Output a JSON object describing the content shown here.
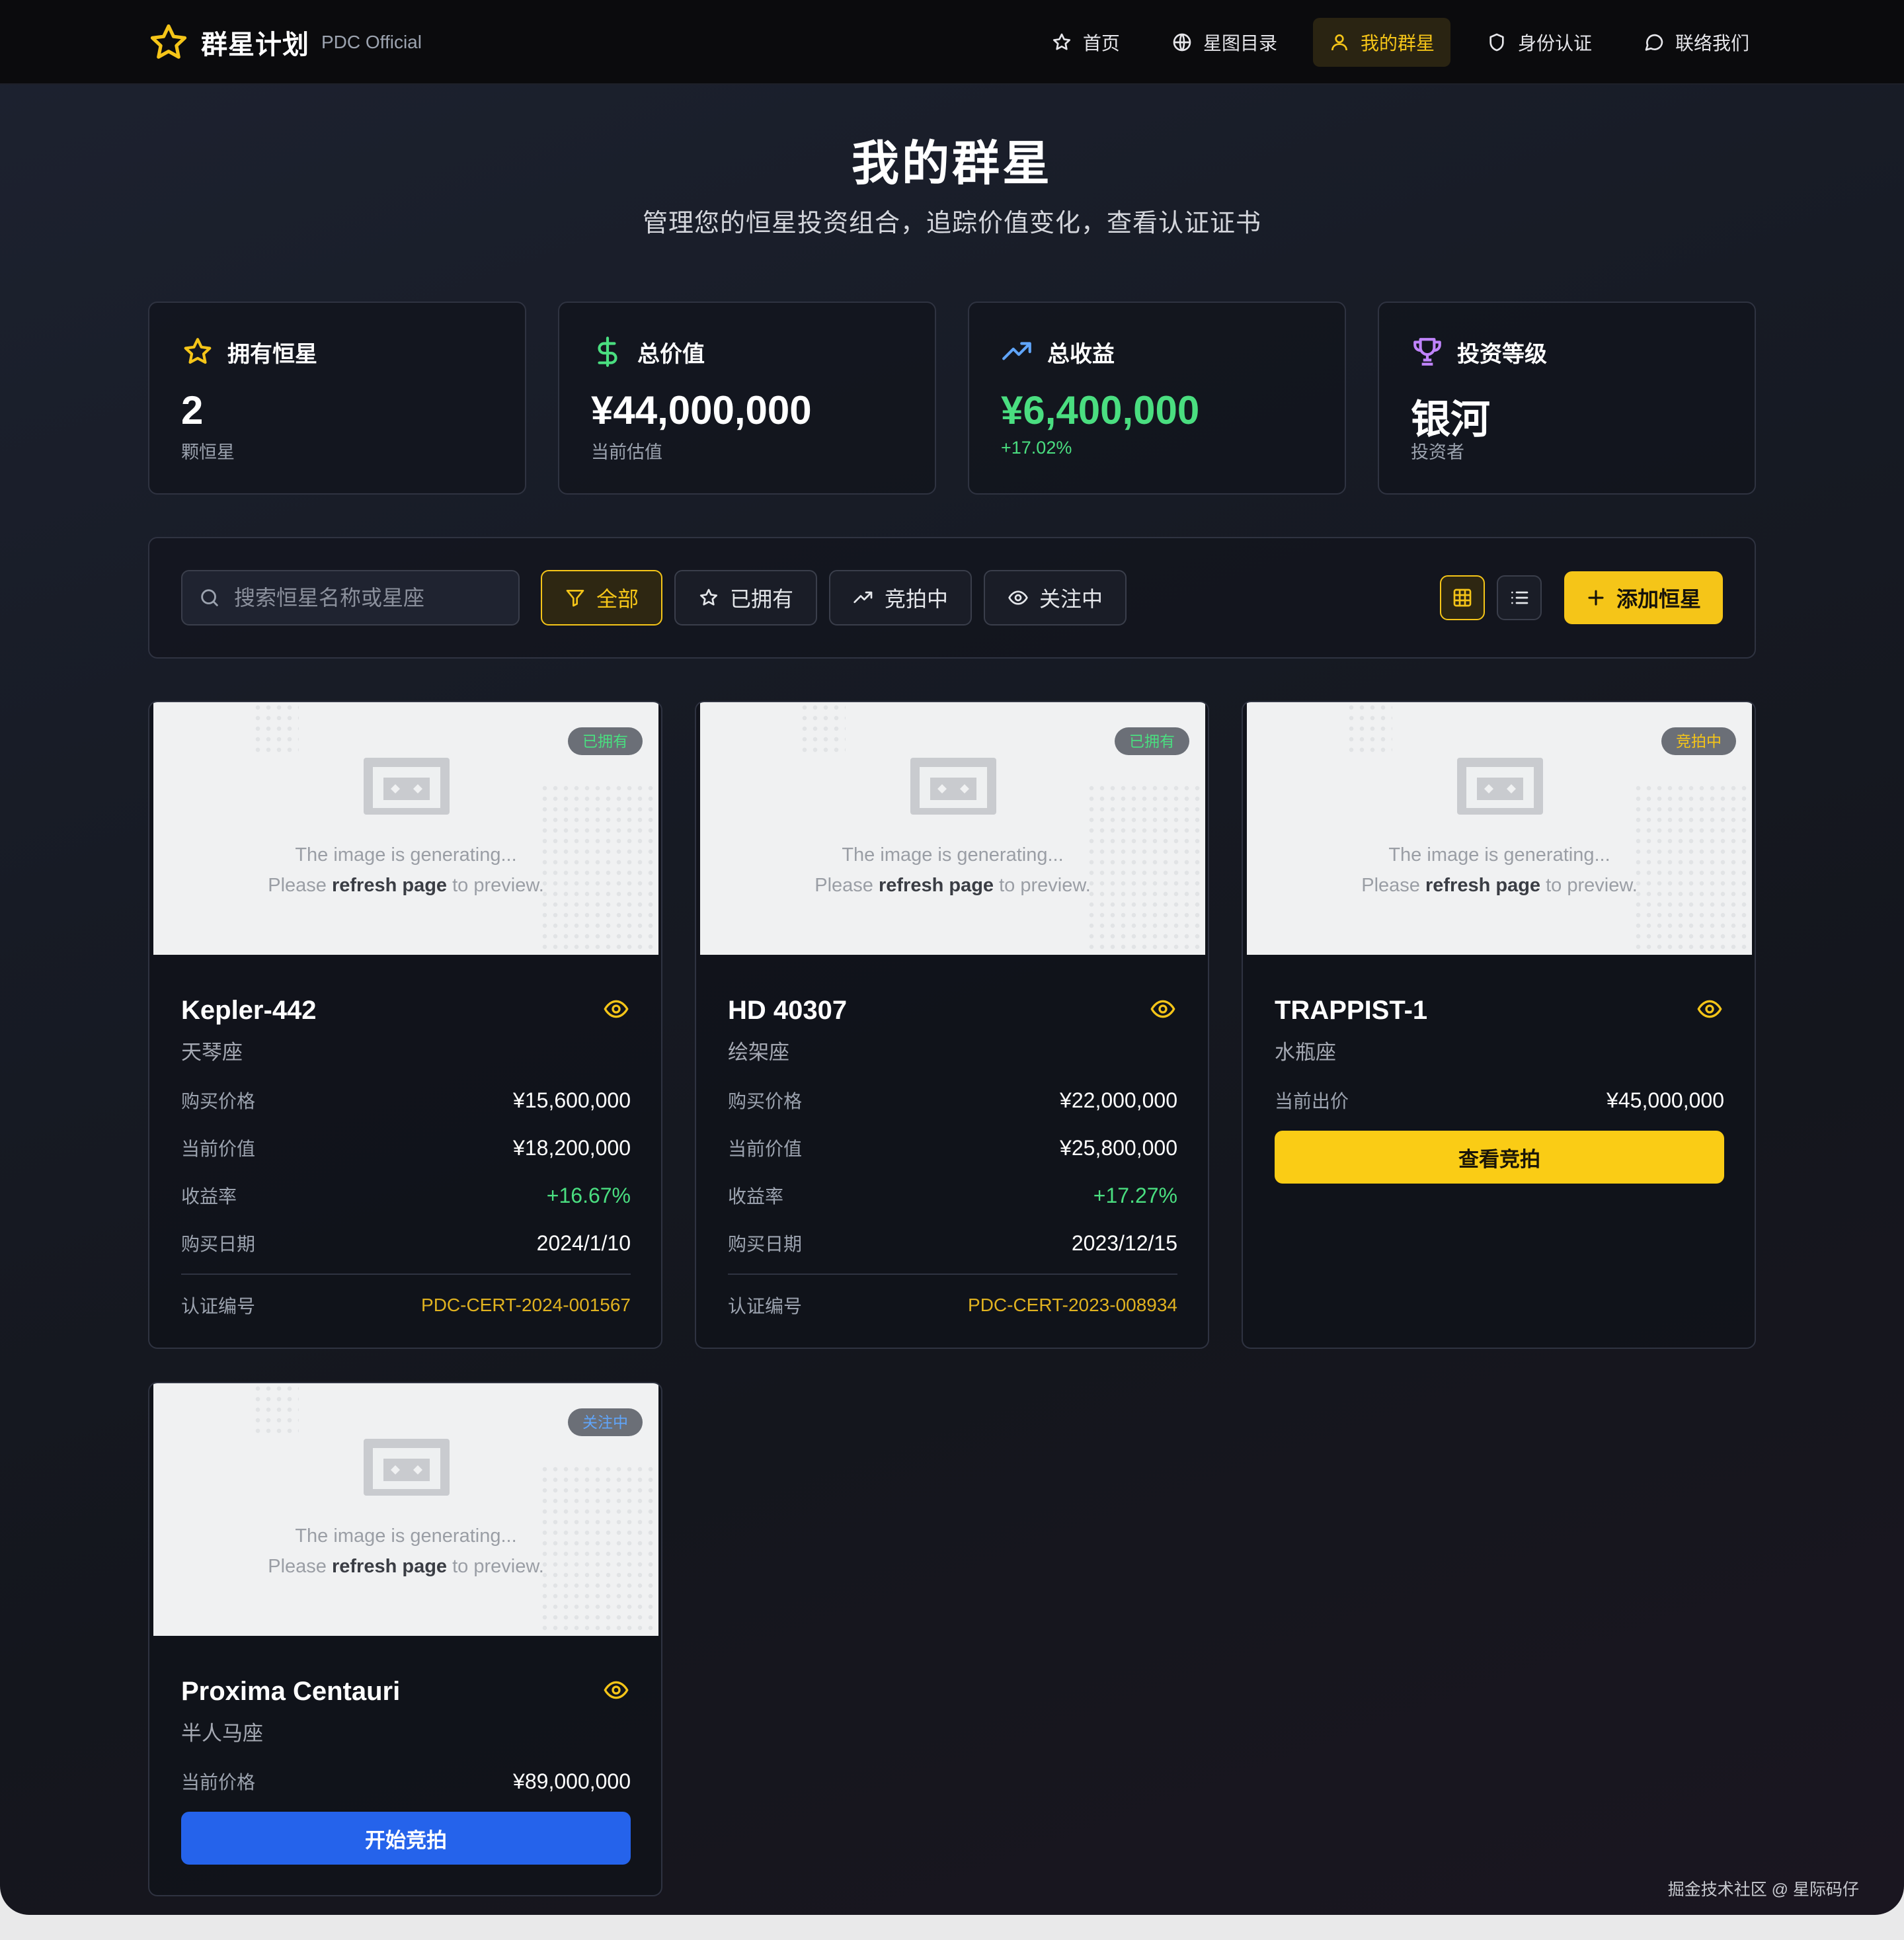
{
  "nav": {
    "brand_name": "群星计划",
    "brand_sub": "PDC Official",
    "links": [
      {
        "label": "首页",
        "icon": "star-icon"
      },
      {
        "label": "星图目录",
        "icon": "globe-icon"
      },
      {
        "label": "我的群星",
        "icon": "user-icon",
        "active": true
      },
      {
        "label": "身份认证",
        "icon": "shield-icon"
      },
      {
        "label": "联络我们",
        "icon": "message-icon"
      }
    ]
  },
  "hero": {
    "title": "我的群星",
    "subtitle": "管理您的恒星投资组合，追踪价值变化，查看认证证书"
  },
  "stats": [
    {
      "label": "拥有恒星",
      "value": "2",
      "note": "颗恒星",
      "icon": "star-outline-icon"
    },
    {
      "label": "总价值",
      "value": "¥44,000,000",
      "note": "当前估值",
      "icon": "dollar-icon"
    },
    {
      "label": "总收益",
      "value": "¥6,400,000",
      "note": "+17.02%",
      "icon": "trending-up-icon"
    },
    {
      "label": "投资等级",
      "value": "银河",
      "note": "投资者",
      "icon": "trophy-icon"
    }
  ],
  "toolbar": {
    "search_placeholder": "搜索恒星名称或星座",
    "filters": [
      {
        "label": "全部",
        "icon": "filter-icon",
        "active": true
      },
      {
        "label": "已拥有",
        "icon": "star-icon"
      },
      {
        "label": "竞拍中",
        "icon": "trending-up-icon"
      },
      {
        "label": "关注中",
        "icon": "eye-icon"
      }
    ],
    "view_grid": "grid-icon",
    "view_list": "list-icon",
    "add_label": "添加恒星"
  },
  "placeholder": {
    "line1": "The image is generating...",
    "line2_pre": "Please ",
    "line2_bold": "refresh page",
    "line2_post": " to preview."
  },
  "cards": [
    {
      "badge": "已拥有",
      "name": "Kepler-442",
      "constellation": "天琴座",
      "rows": [
        {
          "k": "购买价格",
          "v": "¥15,600,000"
        },
        {
          "k": "当前价值",
          "v": "¥18,200,000"
        },
        {
          "k": "收益率",
          "v": "+16.67%"
        },
        {
          "k": "购买日期",
          "v": "2024/1/10"
        }
      ],
      "cert_label": "认证编号",
      "cert_value": "PDC-CERT-2024-001567"
    },
    {
      "badge": "已拥有",
      "name": "HD 40307",
      "constellation": "绘架座",
      "rows": [
        {
          "k": "购买价格",
          "v": "¥22,000,000"
        },
        {
          "k": "当前价值",
          "v": "¥25,800,000"
        },
        {
          "k": "收益率",
          "v": "+17.27%"
        },
        {
          "k": "购买日期",
          "v": "2023/12/15"
        }
      ],
      "cert_label": "认证编号",
      "cert_value": "PDC-CERT-2023-008934"
    },
    {
      "badge": "竞拍中",
      "name": "TRAPPIST-1",
      "constellation": "水瓶座",
      "rows": [
        {
          "k": "当前出价",
          "v": "¥45,000,000"
        }
      ],
      "cta": "查看竞拍"
    },
    {
      "badge": "关注中",
      "name": "Proxima Centauri",
      "constellation": "半人马座",
      "rows": [
        {
          "k": "当前价格",
          "v": "¥89,000,000"
        }
      ],
      "cta": "开始竞拍"
    }
  ],
  "colors": {
    "accent": "#f5c518",
    "green": "#4ade80",
    "blue": "#2563eb",
    "background": "#171b25"
  },
  "watermark": "掘金技术社区 @ 星际码仔"
}
